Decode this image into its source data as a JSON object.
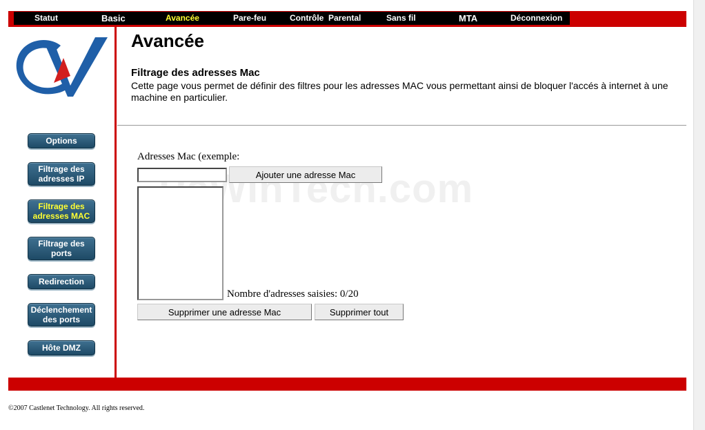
{
  "nav": {
    "items": [
      "Statut",
      "Basic",
      "Avancée",
      "Pare-feu",
      "Contrôle  Parental",
      "Sans fil",
      "MTA",
      "Déconnexion"
    ],
    "active": "Avancée"
  },
  "sidebar": {
    "items": [
      {
        "label": "Options"
      },
      {
        "label": "Filtrage des adresses IP"
      },
      {
        "label": "Filtrage des adresses MAC"
      },
      {
        "label": "Filtrage des ports"
      },
      {
        "label": "Redirection"
      },
      {
        "label": "Déclenchement des ports"
      },
      {
        "label": "Hôte DMZ"
      }
    ],
    "active": "Filtrage des adresses MAC"
  },
  "page": {
    "title": "Avancée",
    "section_title": "Filtrage des adresses Mac",
    "description": "Cette page vous permet de définir des filtres pour les adresses MAC vous permettant ainsi de bloquer l'accés à internet à une machine en particulier."
  },
  "form": {
    "mac_label": "Adresses Mac (exemple:",
    "mac_input_value": "",
    "add_button": "Ajouter une adresse Mac",
    "count_text": "Nombre d'adresses saisies: 0/20",
    "delete_button": "Supprimer une adresse Mac",
    "delete_all_button": "Supprimer tout"
  },
  "watermark": "PcWinTech.com",
  "footer": {
    "copyright": "©2007 Castlenet Technology.  All rights reserved."
  },
  "colors": {
    "accent_red": "#cc0000",
    "nav_active": "#ffff33",
    "button_blue": "#2b5877"
  }
}
